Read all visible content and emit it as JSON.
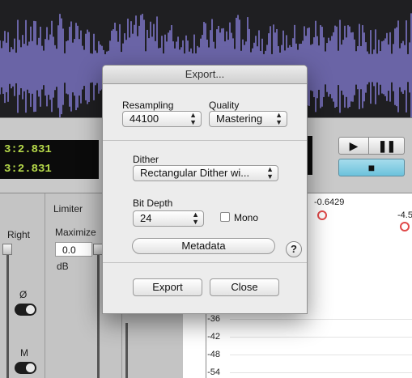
{
  "dialog": {
    "title": "Export...",
    "resampling": {
      "label": "Resampling",
      "value": "44100"
    },
    "quality": {
      "label": "Quality",
      "value": "Mastering"
    },
    "dither": {
      "label": "Dither",
      "value": "Rectangular Dither wi..."
    },
    "bit_depth": {
      "label": "Bit Depth",
      "value": "24"
    },
    "mono": {
      "label": "Mono",
      "checked": false
    },
    "metadata_button": "Metadata",
    "help_button": "?",
    "export_button": "Export",
    "close_button": "Close"
  },
  "transport": {
    "time_1": "3:2.831",
    "time_2": "3:2.831",
    "play_icon": "play-icon",
    "pause_icon": "pause-icon",
    "stop_icon": "stop-icon"
  },
  "mixer": {
    "right_label": "Right",
    "limiter_label": "Limiter",
    "maximize_label": "Maximize",
    "maximize_value": "0.0",
    "db_label": "dB",
    "phase_label": "Ø",
    "m_label": "M"
  },
  "graph": {
    "y_labels": [
      "-36",
      "-42",
      "-48",
      "-54"
    ],
    "peak_labels": [
      "-0.6429",
      "-4.5"
    ]
  },
  "colors": {
    "waveform": "#6a64a6",
    "lcd_text": "#b6d94a",
    "stop_button": "#7ccbe2",
    "peak_marker": "#e04a4a"
  }
}
